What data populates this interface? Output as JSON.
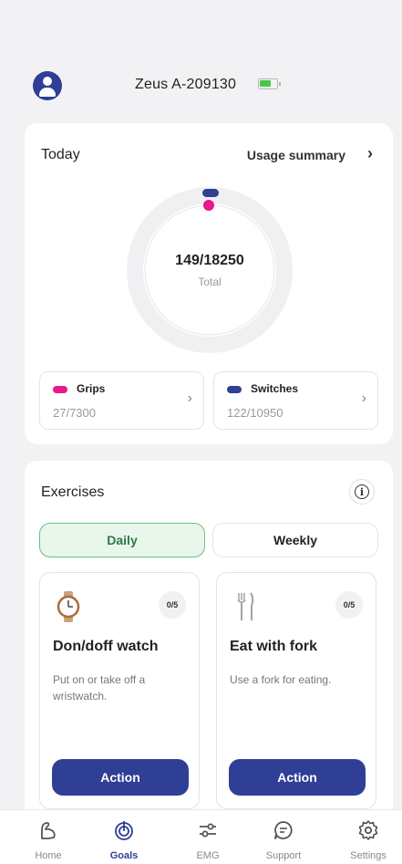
{
  "header": {
    "device_name": "Zeus A-209130"
  },
  "today": {
    "title": "Today",
    "usage_link": "Usage summary",
    "total_value": "149/18250",
    "total_label": "Total",
    "grips": {
      "label": "Grips",
      "value": "27/7300",
      "color": "#e7198c"
    },
    "switches": {
      "label": "Switches",
      "value": "122/10950",
      "color": "#2f3f96"
    }
  },
  "exercises": {
    "title": "Exercises",
    "tabs": {
      "daily": "Daily",
      "weekly": "Weekly"
    },
    "items": [
      {
        "icon": "watch-icon",
        "badge": "0/5",
        "name": "Don/doff watch",
        "description": "Put on or take off a wristwatch.",
        "action": "Action"
      },
      {
        "icon": "fork-knife-icon",
        "badge": "0/5",
        "name": "Eat with fork",
        "description": "Use a fork for eating.",
        "action": "Action"
      }
    ]
  },
  "tabbar": {
    "items": [
      {
        "label": "Home",
        "icon": "arm-icon"
      },
      {
        "label": "Goals",
        "icon": "target-icon",
        "active": true
      },
      {
        "label": "EMG",
        "icon": "sliders-icon"
      },
      {
        "label": "Support",
        "icon": "chat-icon"
      },
      {
        "label": "Settings",
        "icon": "gear-icon"
      }
    ]
  },
  "colors": {
    "primary": "#2f3f96",
    "pink": "#e7198c",
    "active_green": "#68bf84",
    "battery_green": "#4cc64a"
  }
}
